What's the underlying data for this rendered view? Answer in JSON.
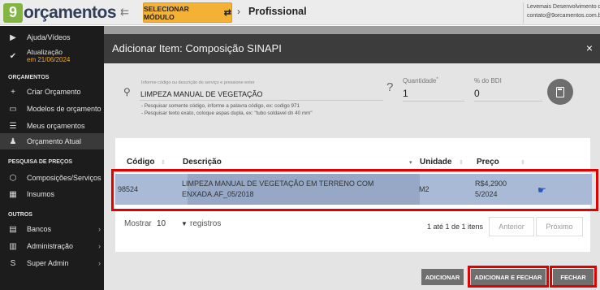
{
  "topbar": {
    "logo_mark": "9",
    "logo_text": "orçamentos",
    "module_button": "SELECIONAR MÓDULO",
    "breadcrumb": "Profissional",
    "account_line1": "Levemais Desenvolvimento de",
    "account_line2": "contato@9orcamentos.com.b"
  },
  "sidebar": {
    "help": "Ajuda/Vídeos",
    "update": "Atualização",
    "update_date": "em 21/06/2024",
    "section_budgets": "ORÇAMENTOS",
    "create_budget": "Criar Orçamento",
    "templates": "Modelos de orçamento",
    "my_budgets": "Meus orçamentos",
    "current_budget": "Orçamento Atual",
    "section_prices": "PESQUISA DE PREÇOS",
    "compositions": "Composições/Serviços",
    "inputs": "Insumos",
    "section_others": "OUTROS",
    "banks": "Bancos",
    "admin": "Administração",
    "super_admin": "Super Admin"
  },
  "modal": {
    "title": "Adicionar Item: Composição SINAPI",
    "close": "×",
    "search_label": "Informe código ou descrição do serviço e pressione enter",
    "search_value": "LIMPEZA MANUAL DE VEGETAÇÃO",
    "hint1": "- Pesquisar somente código, informe a palavra código, ex: codigo 971",
    "hint2": "- Pesquisar texto exato, coloque aspas dupla, ex: \"tubo soldavel dn 40 mm\"",
    "help": "?",
    "quantity_label": "Quantidade",
    "quantity_required": "*",
    "quantity_value": "1",
    "bdi_label": "% do BDI",
    "bdi_value": "0"
  },
  "table": {
    "headers": {
      "code": "Código",
      "description": "Descrição",
      "unit": "Unidade",
      "price": "Preço"
    },
    "rows": [
      {
        "code": "98524",
        "description_line1": "LIMPEZA MANUAL DE VEGETAÇÃO EM TERRENO COM",
        "description_line2": "ENXADA.AF_05/2018",
        "unit": "M2",
        "price_line1": "R$4,2900",
        "price_line2": "5/2024"
      }
    ],
    "show_label": "Mostrar",
    "show_value": "10",
    "records_label": "registros",
    "info": "1 até 1 de 1 itens",
    "prev": "Anterior",
    "next": "Próximo"
  },
  "actions": {
    "add": "ADICIONAR",
    "add_close": "ADICIONAR E FECHAR",
    "close": "FECHAR"
  },
  "colors": {
    "accent": "#f3b233",
    "selected_row": "#a9bad6",
    "highlight": "#e10000",
    "modal_header": "#3c3c3c"
  }
}
